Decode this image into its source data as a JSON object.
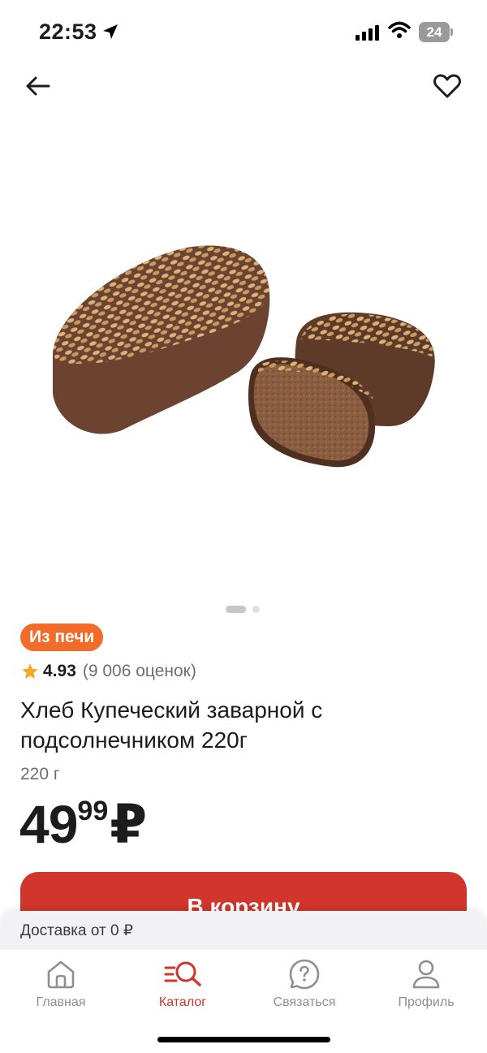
{
  "status_bar": {
    "time": "22:53",
    "battery": "24"
  },
  "product": {
    "badge": "Из печи",
    "rating": "4.93",
    "rating_count": "(9 006 оценок)",
    "title": "Хлеб Купеческий заварной с подсолнечником 220г",
    "weight": "220 г",
    "price_main": "49",
    "price_cents": "99",
    "currency": "₽",
    "image_count": 2,
    "image_index": 1
  },
  "cart_button": {
    "label": "В корзину"
  },
  "delivery": {
    "text": "Доставка от 0 ₽"
  },
  "tabs": [
    {
      "label": "Главная",
      "icon": "home-icon",
      "active": false
    },
    {
      "label": "Каталог",
      "icon": "catalog-search-icon",
      "active": true
    },
    {
      "label": "Связаться",
      "icon": "help-chat-icon",
      "active": false
    },
    {
      "label": "Профиль",
      "icon": "profile-icon",
      "active": false
    }
  ],
  "colors": {
    "accent": "#d1352b",
    "badge": "#f26b2b",
    "star": "#f5a623"
  }
}
